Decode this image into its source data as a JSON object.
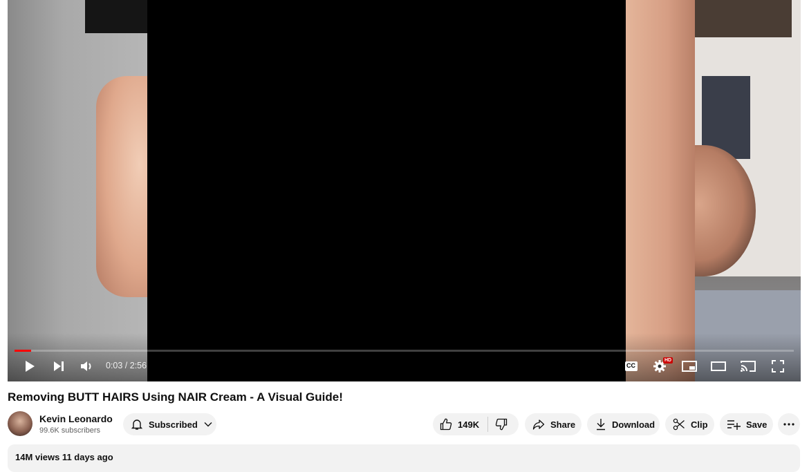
{
  "player": {
    "current_time": "0:03",
    "duration": "2:56",
    "time_display": "0:03 / 2:56",
    "progress_fraction": 0.021,
    "hd_badge": "HD",
    "cc_label": "CC"
  },
  "video": {
    "title": "Removing BUTT HAIRS Using NAIR Cream - A Visual Guide!"
  },
  "channel": {
    "name": "Kevin Leonardo",
    "subscribers": "99.6K subscribers",
    "subscribe_label": "Subscribed"
  },
  "actions": {
    "like_count": "149K",
    "share_label": "Share",
    "download_label": "Download",
    "clip_label": "Clip",
    "save_label": "Save"
  },
  "description": {
    "meta": "14M views  11 days ago"
  },
  "colors": {
    "progress": "#ff0000",
    "pill_bg": "#f2f2f2"
  }
}
